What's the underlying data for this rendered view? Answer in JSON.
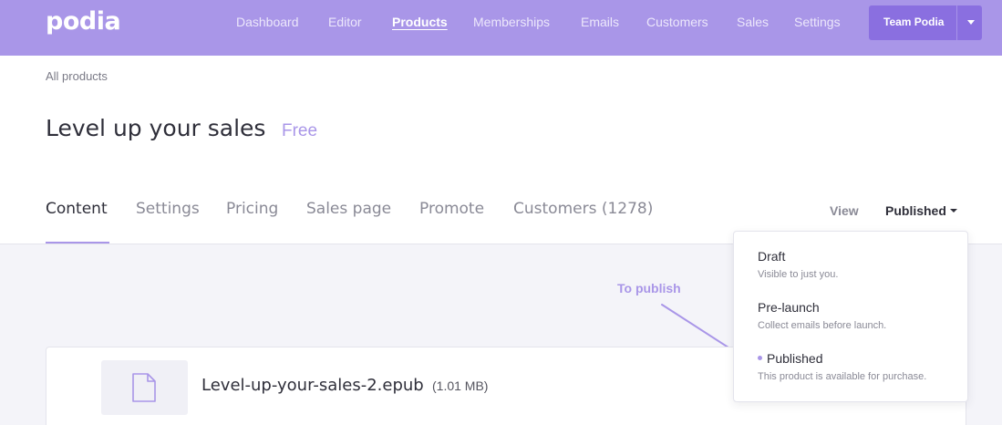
{
  "nav": {
    "logo": "podia",
    "items": [
      {
        "label": "Dashboard"
      },
      {
        "label": "Editor"
      },
      {
        "label": "Products"
      },
      {
        "label": "Memberships"
      },
      {
        "label": "Emails"
      },
      {
        "label": "Customers"
      },
      {
        "label": "Sales"
      },
      {
        "label": "Settings"
      }
    ],
    "active_item": "Products",
    "team_label": "Team Podia"
  },
  "breadcrumb": "All products",
  "product": {
    "title": "Level up your sales",
    "price": "Free"
  },
  "tabs": [
    {
      "label": "Content"
    },
    {
      "label": "Settings"
    },
    {
      "label": "Pricing"
    },
    {
      "label": "Sales page"
    },
    {
      "label": "Promote"
    },
    {
      "label": "Customers (1278)"
    }
  ],
  "active_tab": "Content",
  "view": {
    "label": "View",
    "status": "Published"
  },
  "annotation": "To publish",
  "file": {
    "name": "Level-up-your-sales-2.epub",
    "size": "(1.01 MB)",
    "icon": "file-icon"
  },
  "status_menu": {
    "options": [
      {
        "title": "Draft",
        "description": "Visible to just you."
      },
      {
        "title": "Pre-launch",
        "description": "Collect emails before launch."
      },
      {
        "title": "Published",
        "description": "This product is available for purchase."
      }
    ],
    "selected": "Published"
  },
  "colors": {
    "brand": "#a996e8",
    "brand_dark": "#8a6fe0",
    "text": "#2f2f3a",
    "muted": "#8a8a96",
    "background": "#f4f4f9"
  }
}
